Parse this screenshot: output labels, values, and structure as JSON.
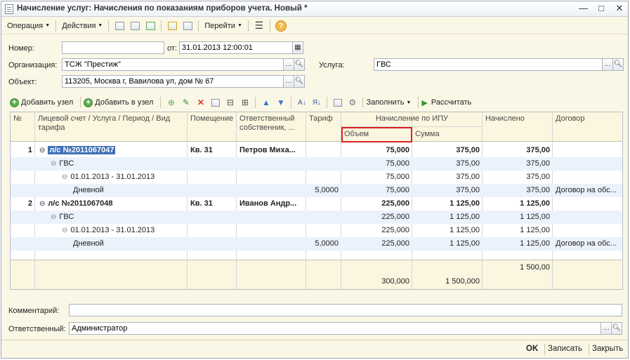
{
  "window": {
    "title": "Начисление услуг: Начисления по показаниям приборов учета. Новый *",
    "controls": [
      "—",
      "□",
      "✕"
    ]
  },
  "toolbar": {
    "operation": "Операция",
    "actions": "Действия",
    "goto": "Перейти",
    "help": "?"
  },
  "form": {
    "number_label": "Номер:",
    "number_value": "",
    "date_label": "от:",
    "date_value": "31.01.2013 12:00:01",
    "org_label": "Организация:",
    "org_value": "ТСЖ \"Престиж\"",
    "service_label": "Услуга:",
    "service_value": "ГВС",
    "object_label": "Объект:",
    "object_value": "113205, Москва г, Вавилова ул, дом № 67"
  },
  "table_toolbar": {
    "add_node": "Добавить узел",
    "add_to_node": "Добавить в узел",
    "fill": "Заполнить",
    "calculate": "Рассчитать"
  },
  "grid": {
    "headers": {
      "num": "№",
      "account": "Лицевой счет / Услуга / Период / Вид тарифа",
      "room": "Помещение",
      "owner": "Ответственный собственник, ...",
      "tariff": "Тариф",
      "ipu_group": "Начисление по ИПУ",
      "volume": "Объем",
      "sum": "Сумма",
      "accrued": "Начислено",
      "contract": "Договор"
    },
    "rows": [
      {
        "num": "1",
        "tree": "⊖",
        "text": "л/с №2011067047",
        "room": "Кв. 31",
        "owner": "Петров Миха...",
        "tariff": "",
        "volume": "75,000",
        "sum": "375,00",
        "accrued": "375,00",
        "contract": ""
      },
      {
        "num": "",
        "tree": "⊖",
        "text": "ГВС",
        "room": "",
        "owner": "",
        "tariff": "",
        "volume": "75,000",
        "sum": "375,00",
        "accrued": "375,00",
        "contract": ""
      },
      {
        "num": "",
        "tree": "⊖",
        "text": "01.01.2013 - 31.01.2013",
        "room": "",
        "owner": "",
        "tariff": "",
        "volume": "75,000",
        "sum": "375,00",
        "accrued": "375,00",
        "contract": ""
      },
      {
        "num": "",
        "tree": "",
        "text": "Дневной",
        "room": "",
        "owner": "",
        "tariff": "5,0000",
        "volume": "75,000",
        "sum": "375,00",
        "accrued": "375,00",
        "contract": "Договор на обс..."
      },
      {
        "num": "2",
        "tree": "⊖",
        "text": "л/с №2011067048",
        "room": "Кв. 31",
        "owner": "Иванов Андр...",
        "tariff": "",
        "volume": "225,000",
        "sum": "1 125,00",
        "accrued": "1 125,00",
        "contract": ""
      },
      {
        "num": "",
        "tree": "⊖",
        "text": "ГВС",
        "room": "",
        "owner": "",
        "tariff": "",
        "volume": "225,000",
        "sum": "1 125,00",
        "accrued": "1 125,00",
        "contract": ""
      },
      {
        "num": "",
        "tree": "⊖",
        "text": "01.01.2013 - 31.01.2013",
        "room": "",
        "owner": "",
        "tariff": "",
        "volume": "225,000",
        "sum": "1 125,00",
        "accrued": "1 125,00",
        "contract": ""
      },
      {
        "num": "",
        "tree": "",
        "text": "Дневной",
        "room": "",
        "owner": "",
        "tariff": "5,0000",
        "volume": "225,000",
        "sum": "1 125,00",
        "accrued": "1 125,00",
        "contract": "Договор на обс..."
      }
    ],
    "totals": {
      "accrued": "1 500,00",
      "volume": "300,000",
      "sum": "1 500,000"
    }
  },
  "bottom": {
    "comment_label": "Комментарий:",
    "comment_value": "",
    "responsible_label": "Ответственный:",
    "responsible_value": "Администратор",
    "ok": "OK",
    "save": "Записать",
    "close": "Закрыть"
  }
}
